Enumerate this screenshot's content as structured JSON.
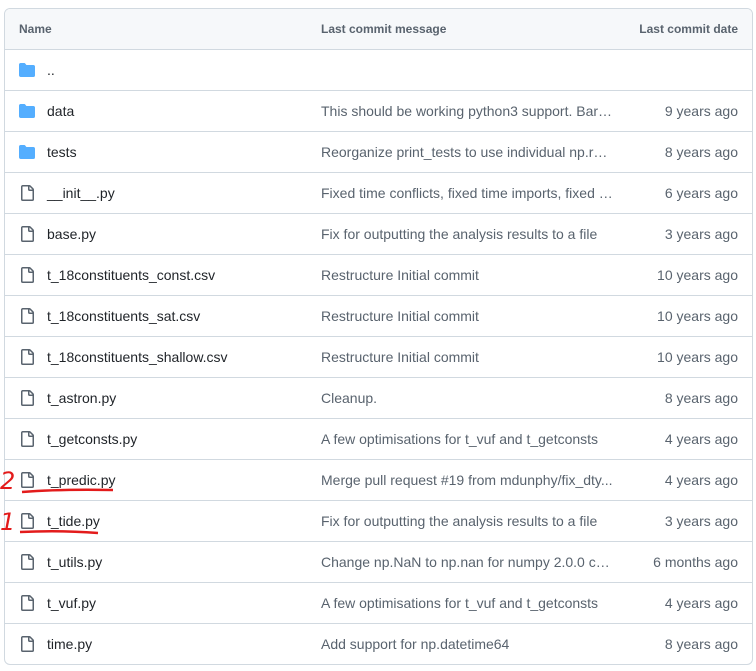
{
  "header": {
    "name": "Name",
    "message": "Last commit message",
    "date": "Last commit date"
  },
  "rows": [
    {
      "type": "folder",
      "name": "..",
      "message": "",
      "date": ""
    },
    {
      "type": "folder",
      "name": "data",
      "message": "This should be working python3 support. Bare...",
      "date": "9 years ago"
    },
    {
      "type": "folder",
      "name": "tests",
      "message": "Reorganize print_tests to use individual np.ran...",
      "date": "8 years ago"
    },
    {
      "type": "file",
      "name": "__init__.py",
      "message": "Fixed time conflicts, fixed time imports, fixed p...",
      "date": "6 years ago"
    },
    {
      "type": "file",
      "name": "base.py",
      "message": "Fix for outputting the analysis results to a file",
      "date": "3 years ago"
    },
    {
      "type": "file",
      "name": "t_18constituents_const.csv",
      "message": "Restructure Initial commit",
      "date": "10 years ago"
    },
    {
      "type": "file",
      "name": "t_18constituents_sat.csv",
      "message": "Restructure Initial commit",
      "date": "10 years ago"
    },
    {
      "type": "file",
      "name": "t_18constituents_shallow.csv",
      "message": "Restructure Initial commit",
      "date": "10 years ago"
    },
    {
      "type": "file",
      "name": "t_astron.py",
      "message": "Cleanup.",
      "date": "8 years ago"
    },
    {
      "type": "file",
      "name": "t_getconsts.py",
      "message": "A few optimisations for t_vuf and t_getconsts",
      "date": "4 years ago"
    },
    {
      "type": "file",
      "name": "t_predic.py",
      "message": "Merge pull request #19 from mdunphy/fix_dty...",
      "date": "4 years ago"
    },
    {
      "type": "file",
      "name": "t_tide.py",
      "message": "Fix for outputting the analysis results to a file",
      "date": "3 years ago"
    },
    {
      "type": "file",
      "name": "t_utils.py",
      "message": "Change np.NaN to np.nan for numpy 2.0.0 co...",
      "date": "6 months ago"
    },
    {
      "type": "file",
      "name": "t_vuf.py",
      "message": "A few optimisations for t_vuf and t_getconsts",
      "date": "4 years ago"
    },
    {
      "type": "file",
      "name": "time.py",
      "message": "Add support for np.datetime64",
      "date": "8 years ago"
    }
  ],
  "annotations": {
    "mark_predic": "2",
    "mark_tide": "1",
    "color": "#e31b1b"
  },
  "colors": {
    "folder": "#54aeff",
    "file": "#59636e",
    "border": "#d1d9e0"
  }
}
